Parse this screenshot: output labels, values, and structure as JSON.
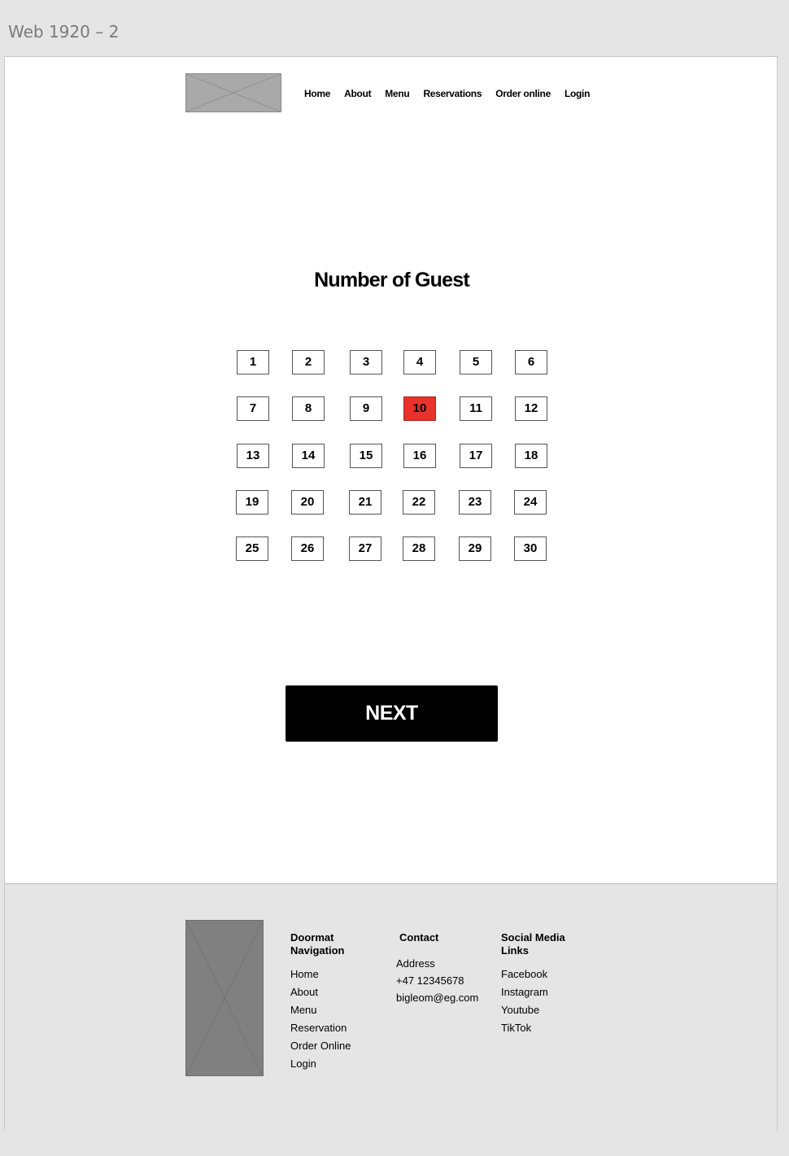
{
  "artboard_label": "Web 1920 – 2",
  "nav": {
    "items": [
      "Home",
      "About",
      "Menu",
      "Reservations",
      "Order online",
      "Login"
    ]
  },
  "main": {
    "title": "Number of Guest",
    "guests": [
      "1",
      "2",
      "3",
      "4",
      "5",
      "6",
      "7",
      "8",
      "9",
      "10",
      "11",
      "12",
      "13",
      "14",
      "15",
      "16",
      "17",
      "18",
      "19",
      "20",
      "21",
      "22",
      "23",
      "24",
      "25",
      "26",
      "27",
      "28",
      "29",
      "30"
    ],
    "selected": "10",
    "next_label": "NEXT"
  },
  "footer": {
    "nav_heading": "Doormat Navigation",
    "nav_links": [
      "Home",
      "About",
      "Menu",
      "Reservation",
      "Order Online",
      "Login"
    ],
    "contact_heading": "Contact",
    "contact_lines": [
      "Address",
      "+47 12345678",
      "bigleom@eg.com"
    ],
    "social_heading": "Social Media Links",
    "social_links": [
      "Facebook",
      "Instagram",
      "Youtube",
      "TikTok"
    ]
  },
  "colors": {
    "selected_fill": "#e8322b",
    "button_black": "#000000",
    "footer_bg": "#e5e5e5",
    "placeholder_gray": "#808080"
  }
}
